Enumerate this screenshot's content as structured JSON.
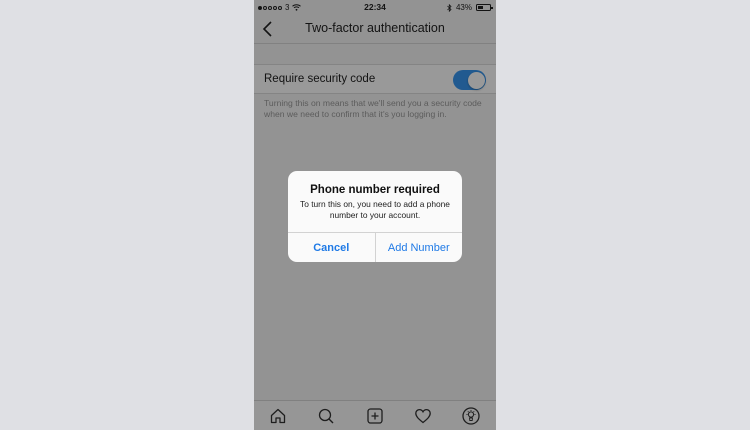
{
  "status_bar": {
    "carrier": "3",
    "time": "22:34",
    "battery": "43%",
    "battery_level": 0.43
  },
  "nav": {
    "title": "Two-factor authentication",
    "back_icon": "chevron-left-icon"
  },
  "setting": {
    "label": "Require security code",
    "enabled": true,
    "description": "Turning this on means that we'll send you a security code when we need to confirm that it's you logging in."
  },
  "dialog": {
    "title": "Phone number required",
    "message": "To turn this on, you need to add a phone number to your account.",
    "cancel_label": "Cancel",
    "confirm_label": "Add Number"
  },
  "tab_bar": {
    "tabs": [
      "home-icon",
      "search-icon",
      "add-icon",
      "heart-icon",
      "profile-icon"
    ]
  },
  "colors": {
    "accent": "#3897f0",
    "dialog_button": "#1f7ae6",
    "page_background": "#dfe0e4"
  }
}
